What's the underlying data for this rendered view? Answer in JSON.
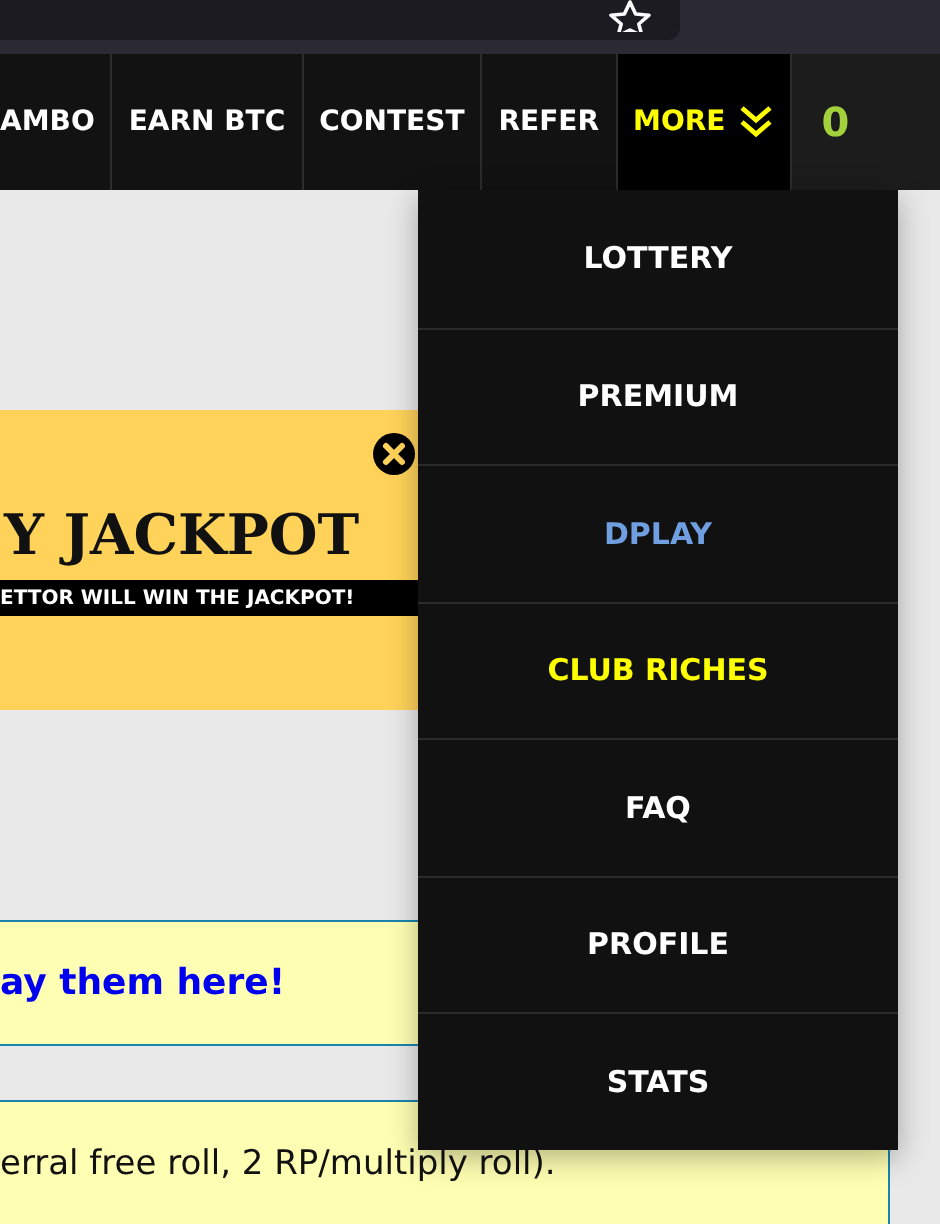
{
  "nav": {
    "items": [
      {
        "label": "AMBO",
        "selected": false
      },
      {
        "label": "EARN BTC",
        "selected": false
      },
      {
        "label": "CONTEST",
        "selected": false
      },
      {
        "label": "REFER",
        "selected": false
      },
      {
        "label": "MORE",
        "selected": true
      }
    ],
    "balance": "0"
  },
  "banner": {
    "title": "Y JACKPOT",
    "subtitle": "ETTOR WILL WIN THE JACKPOT!"
  },
  "notices": [
    {
      "text": "ay them here!",
      "kind": "link"
    },
    {
      "text": "erral free roll, 2 RP/multiply roll).",
      "kind": "text"
    }
  ],
  "dropdown": {
    "items": [
      {
        "label": "LOTTERY",
        "color": "#ffffff"
      },
      {
        "label": "PREMIUM",
        "color": "#ffffff"
      },
      {
        "label": "DPLAY",
        "color": "#6f9fe0"
      },
      {
        "label": "CLUB RICHES",
        "color": "#ffff00"
      },
      {
        "label": "FAQ",
        "color": "#ffffff"
      },
      {
        "label": "PROFILE",
        "color": "#ffffff"
      },
      {
        "label": "STATS",
        "color": "#ffffff"
      }
    ]
  }
}
